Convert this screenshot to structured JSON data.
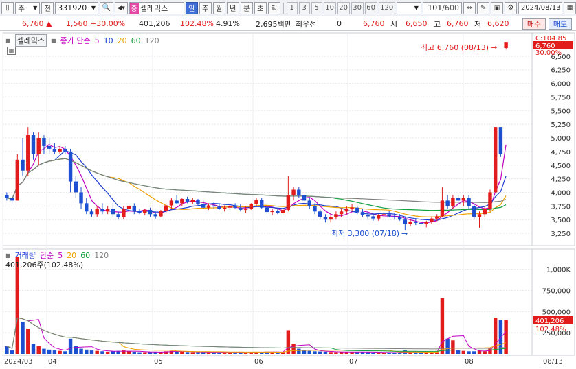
{
  "toolbar": {
    "market_type": "주",
    "scope": "전",
    "code": "331920",
    "name_badge": "증",
    "stock_name": "셀레믹스",
    "periods": [
      "일",
      "주",
      "월",
      "년",
      "분",
      "초",
      "틱"
    ],
    "active_period": "일",
    "intervals": [
      "1",
      "3",
      "5",
      "10",
      "20",
      "30",
      "60",
      "120"
    ],
    "count": "101",
    "count_total": "/600",
    "date": "2024/08/13"
  },
  "quote": {
    "price": "6,760",
    "change": "1,560",
    "change_pct": "+30.00%",
    "volume": "401,206",
    "volume_ratio": "102.48%",
    "turnover": "4.91%",
    "amount": "2,695백만",
    "priority_label": "최우선",
    "priority_value": "0",
    "ask": "6,760",
    "open_label": "시",
    "open": "6,650",
    "high_label": "고",
    "high": "6,760",
    "low_label": "저",
    "low": "6,620",
    "buy_label": "매수",
    "sell_label": "매도"
  },
  "price_panel": {
    "legend_name": "셀레믹스",
    "ma_label": "종가 단순",
    "ma_periods": [
      "5",
      "10",
      "20",
      "60",
      "120"
    ],
    "ma_colors": [
      "#c000c0",
      "#1d3fd0",
      "#f0a000",
      "#10a040",
      "#808080"
    ],
    "high_annotation": "최고 6,760 (08/13)",
    "low_annotation": "최저 3,300 (07/18)",
    "tag_top": "C:104.85",
    "tag_price": "6,760",
    "tag_pct": "30.00%"
  },
  "volume_panel": {
    "legend_name": "거래량",
    "ma_label": "단순",
    "ma_periods": [
      "5",
      "20",
      "60",
      "120"
    ],
    "current": "401,206주(102.48%)",
    "tag_volume": "401,206",
    "tag_pct": "102.48%"
  },
  "x_axis": {
    "labels": [
      "2024/03",
      "04",
      "05",
      "06",
      "07",
      "08"
    ],
    "right_label": "08/13"
  },
  "chart_data": {
    "type": "candlestick",
    "price_axis": {
      "ticks": [
        3250,
        3500,
        3750,
        4000,
        4250,
        4500,
        4750,
        5000,
        5250,
        5500,
        5750,
        6000,
        6250,
        6500
      ],
      "range": [
        3100,
        6800
      ]
    },
    "volume_axis": {
      "ticks": [
        250000,
        500000,
        750000,
        1000000
      ],
      "tick_labels": [
        "250,000",
        "500,000",
        "750,000",
        "1,000K"
      ],
      "range": [
        0,
        1200000
      ]
    },
    "candles": [
      [
        3950,
        4000,
        3850,
        3900,
        90000
      ],
      [
        3900,
        3950,
        3800,
        3850,
        40000
      ],
      [
        3850,
        4700,
        3850,
        4600,
        1150000
      ],
      [
        4600,
        5000,
        4300,
        4400,
        380000
      ],
      [
        4400,
        5200,
        4300,
        5050,
        300000
      ],
      [
        5050,
        5100,
        4600,
        4700,
        120000
      ],
      [
        4700,
        5100,
        4500,
        5000,
        90000
      ],
      [
        5000,
        5050,
        4700,
        4850,
        60000
      ],
      [
        4850,
        5000,
        4700,
        4800,
        50000
      ],
      [
        4800,
        4900,
        4700,
        4750,
        40000
      ],
      [
        4750,
        4850,
        4700,
        4800,
        35000
      ],
      [
        4800,
        4850,
        4700,
        4750,
        30000
      ],
      [
        4750,
        4800,
        4000,
        4200,
        180000
      ],
      [
        4200,
        4300,
        3900,
        4000,
        90000
      ],
      [
        4000,
        4100,
        3700,
        3800,
        60000
      ],
      [
        3800,
        3900,
        3600,
        3650,
        50000
      ],
      [
        3650,
        3700,
        3550,
        3600,
        40000
      ],
      [
        3600,
        3750,
        3550,
        3700,
        35000
      ],
      [
        3700,
        3800,
        3600,
        3650,
        30000
      ],
      [
        3650,
        3750,
        3600,
        3700,
        25000
      ],
      [
        3700,
        3800,
        3550,
        3600,
        30000
      ],
      [
        3600,
        3650,
        3500,
        3550,
        35000
      ],
      [
        3550,
        3750,
        3500,
        3700,
        40000
      ],
      [
        3700,
        3800,
        3650,
        3750,
        30000
      ],
      [
        3750,
        3800,
        3600,
        3650,
        25000
      ],
      [
        3650,
        3700,
        3600,
        3620,
        20000
      ],
      [
        3620,
        3700,
        3580,
        3680,
        20000
      ],
      [
        3680,
        3720,
        3550,
        3600,
        22000
      ],
      [
        3600,
        3650,
        3520,
        3560,
        25000
      ],
      [
        3560,
        3680,
        3540,
        3660,
        20000
      ],
      [
        3660,
        3800,
        3620,
        3760,
        30000
      ],
      [
        3760,
        3900,
        3700,
        3850,
        35000
      ],
      [
        3850,
        3950,
        3780,
        3800,
        30000
      ],
      [
        3800,
        3900,
        3750,
        3880,
        25000
      ],
      [
        3880,
        3920,
        3800,
        3820,
        22000
      ],
      [
        3820,
        3900,
        3780,
        3860,
        20000
      ],
      [
        3860,
        3880,
        3750,
        3780,
        20000
      ],
      [
        3780,
        3850,
        3700,
        3720,
        22000
      ],
      [
        3720,
        3800,
        3680,
        3760,
        20000
      ],
      [
        3760,
        3820,
        3700,
        3740,
        18000
      ],
      [
        3740,
        3800,
        3680,
        3700,
        18000
      ],
      [
        3700,
        3760,
        3650,
        3720,
        17000
      ],
      [
        3720,
        3780,
        3680,
        3750,
        16000
      ],
      [
        3750,
        3800,
        3700,
        3720,
        15000
      ],
      [
        3720,
        3780,
        3650,
        3680,
        16000
      ],
      [
        3680,
        3750,
        3620,
        3700,
        18000
      ],
      [
        3700,
        3800,
        3680,
        3780,
        20000
      ],
      [
        3780,
        3900,
        3750,
        3860,
        24000
      ],
      [
        3860,
        3900,
        3700,
        3720,
        22000
      ],
      [
        3720,
        3780,
        3600,
        3640,
        25000
      ],
      [
        3640,
        3700,
        3580,
        3660,
        20000
      ],
      [
        3660,
        3720,
        3600,
        3620,
        18000
      ],
      [
        3620,
        3700,
        3580,
        3680,
        20000
      ],
      [
        3680,
        4300,
        3650,
        3950,
        280000
      ],
      [
        3950,
        4100,
        3850,
        4050,
        120000
      ],
      [
        4050,
        4100,
        3900,
        3950,
        60000
      ],
      [
        3950,
        4000,
        3800,
        3850,
        40000
      ],
      [
        3850,
        3900,
        3700,
        3750,
        35000
      ],
      [
        3750,
        3800,
        3600,
        3650,
        30000
      ],
      [
        3650,
        3700,
        3500,
        3550,
        28000
      ],
      [
        3550,
        3600,
        3450,
        3500,
        25000
      ],
      [
        3500,
        3600,
        3450,
        3550,
        22000
      ],
      [
        3550,
        3650,
        3500,
        3600,
        20000
      ],
      [
        3600,
        3700,
        3550,
        3650,
        22000
      ],
      [
        3650,
        3750,
        3600,
        3700,
        25000
      ],
      [
        3700,
        3780,
        3650,
        3720,
        20000
      ],
      [
        3720,
        3760,
        3600,
        3640,
        22000
      ],
      [
        3640,
        3700,
        3550,
        3580,
        25000
      ],
      [
        3580,
        3650,
        3500,
        3560,
        20000
      ],
      [
        3560,
        3620,
        3480,
        3520,
        18000
      ],
      [
        3520,
        3600,
        3480,
        3580,
        16000
      ],
      [
        3580,
        3640,
        3520,
        3600,
        15000
      ],
      [
        3600,
        3660,
        3540,
        3560,
        16000
      ],
      [
        3560,
        3620,
        3500,
        3540,
        15000
      ],
      [
        3540,
        3600,
        3480,
        3500,
        16000
      ],
      [
        3500,
        3560,
        3300,
        3420,
        40000
      ],
      [
        3420,
        3500,
        3380,
        3460,
        20000
      ],
      [
        3460,
        3520,
        3400,
        3440,
        18000
      ],
      [
        3440,
        3500,
        3380,
        3420,
        16000
      ],
      [
        3420,
        3480,
        3360,
        3460,
        15000
      ],
      [
        3460,
        3560,
        3420,
        3520,
        20000
      ],
      [
        3520,
        3600,
        3480,
        3560,
        20000
      ],
      [
        3560,
        4100,
        3550,
        3850,
        660000
      ],
      [
        3850,
        3950,
        3700,
        3750,
        180000
      ],
      [
        3750,
        3950,
        3700,
        3900,
        160000
      ],
      [
        3900,
        3950,
        3800,
        3850,
        40000
      ],
      [
        3850,
        3950,
        3750,
        3900,
        35000
      ],
      [
        3900,
        3950,
        3700,
        3750,
        30000
      ],
      [
        3750,
        3800,
        3500,
        3550,
        30000
      ],
      [
        3550,
        3650,
        3350,
        3600,
        40000
      ],
      [
        3600,
        3750,
        3550,
        3700,
        30000
      ],
      [
        3700,
        4050,
        3650,
        4000,
        60000
      ],
      [
        4000,
        5200,
        4000,
        5200,
        430000
      ],
      [
        5200,
        5200,
        4650,
        4700,
        401206
      ],
      [
        6650,
        6760,
        6620,
        6760,
        401206
      ]
    ]
  }
}
